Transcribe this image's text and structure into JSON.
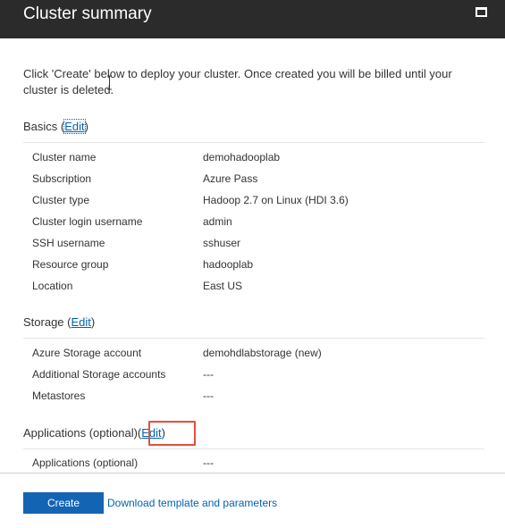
{
  "window": {
    "title": "Cluster summary",
    "maximize_icon": "maximize-icon"
  },
  "intro_text": "Click 'Create' below to deploy your cluster. Once created you will be billed until your cluster is deleted.",
  "sections": {
    "basics": {
      "title": "Basics",
      "edit_label": "Edit",
      "rows": [
        {
          "label": "Cluster name",
          "value": "demohadooplab"
        },
        {
          "label": "Subscription",
          "value": "Azure Pass"
        },
        {
          "label": "Cluster type",
          "value": "Hadoop 2.7 on Linux (HDI 3.6)"
        },
        {
          "label": "Cluster login username",
          "value": "admin"
        },
        {
          "label": "SSH username",
          "value": "sshuser"
        },
        {
          "label": "Resource group",
          "value": "hadooplab"
        },
        {
          "label": "Location",
          "value": "East US"
        }
      ]
    },
    "storage": {
      "title": "Storage",
      "edit_label": "Edit",
      "rows": [
        {
          "label": "Azure Storage account",
          "value": "demohdlabstorage (new)"
        },
        {
          "label": "Additional Storage accounts",
          "value": "---"
        },
        {
          "label": "Metastores",
          "value": "---"
        }
      ]
    },
    "applications": {
      "title": "Applications (optional)",
      "edit_label": "Edit",
      "rows": [
        {
          "label": "Applications (optional)",
          "value": "---"
        }
      ]
    }
  },
  "footer": {
    "create_label": "Create",
    "download_label": "Download template and parameters"
  },
  "colors": {
    "titlebar": "#2b2b2b",
    "link": "#0063b1",
    "primary_button": "#1464b4",
    "highlight_box": "#e74c3c"
  }
}
